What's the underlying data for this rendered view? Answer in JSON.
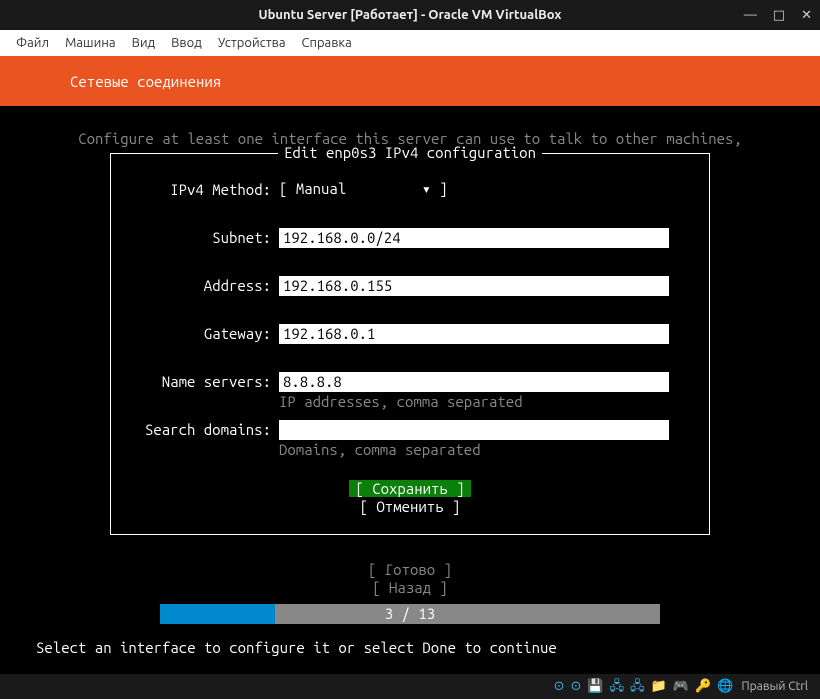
{
  "virtualbox": {
    "title": "Ubuntu Server [Работает] - Oracle VM VirtualBox",
    "menu": {
      "file": "Файл",
      "machine": "Машина",
      "view": "Вид",
      "input": "Ввод",
      "devices": "Устройства",
      "help": "Справка"
    },
    "windowControls": {
      "min": "—",
      "max": "□",
      "close": "✕"
    },
    "statusbar": {
      "hostKey": "Правый Ctrl",
      "icons": [
        "⊙",
        "⊙",
        "💾",
        "🖧",
        "🖧",
        "📁",
        "🎮",
        "🔑",
        "🌐"
      ]
    }
  },
  "installer": {
    "headerTitle": "Сетевые соединения",
    "helpLine": "Configure at least one interface this server can use to talk to other machines,",
    "dialog": {
      "title": "Edit enp0s3 IPv4 configuration",
      "method": {
        "label": "IPv4 Method:",
        "value": "Manual"
      },
      "fields": {
        "subnet": {
          "label": "Subnet:",
          "value": "192.168.0.0/24",
          "hint": ""
        },
        "address": {
          "label": "Address:",
          "value": "192.168.0.155",
          "hint": ""
        },
        "gateway": {
          "label": "Gateway:",
          "value": "192.168.0.1",
          "hint": ""
        },
        "ns": {
          "label": "Name servers:",
          "value": "8.8.8.8",
          "hint": "IP addresses, comma separated"
        },
        "search": {
          "label": "Search domains:",
          "value": "",
          "hint": "Domains, comma separated"
        }
      },
      "buttons": {
        "save": "[ Сохранить ]",
        "cancel": "[ Отменить  ]"
      }
    },
    "lowerButtons": {
      "done": "[ Готово    ]",
      "back": "[ Назад     ]"
    },
    "progress": {
      "text": "3 / 13",
      "current": 3,
      "total": 13
    },
    "footerHelp": "Select an interface to configure it or select Done to continue"
  }
}
